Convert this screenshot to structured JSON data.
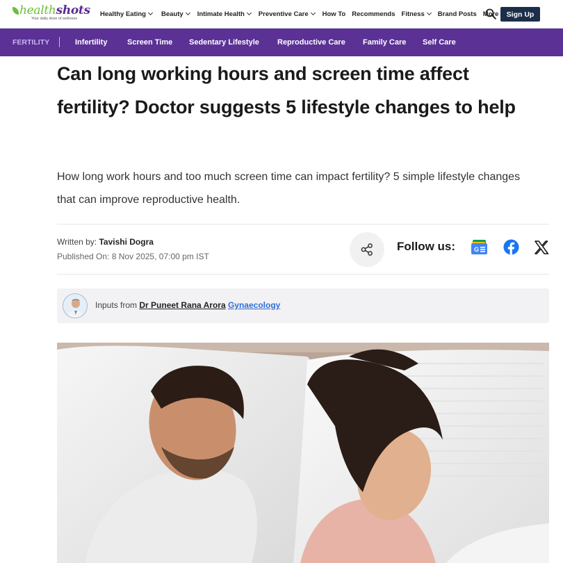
{
  "brand": {
    "logo_prefix": "health",
    "logo_suffix": "shots",
    "tagline": "Your daily dose of wellness",
    "colors": {
      "green": "#6abf3c",
      "purple": "#5b3196",
      "navy": "#1c2e4a"
    }
  },
  "header": {
    "nav": [
      {
        "label": "Healthy Eating",
        "dropdown": true
      },
      {
        "label": "Beauty",
        "dropdown": true
      },
      {
        "label": "Intimate Health",
        "dropdown": true
      },
      {
        "label": "Preventive Care",
        "dropdown": true
      },
      {
        "label": "How To",
        "dropdown": false
      },
      {
        "label": "Recommends",
        "dropdown": false
      },
      {
        "label": "Fitness",
        "dropdown": true
      },
      {
        "label": "Brand Posts",
        "dropdown": false
      },
      {
        "label": "More",
        "dropdown": true
      }
    ],
    "search_icon": "search-icon",
    "signup_label": "Sign Up"
  },
  "subnav": {
    "category": "FERTILITY",
    "items": [
      "Infertility",
      "Screen Time",
      "Sedentary Lifestyle",
      "Reproductive Care",
      "Family Care",
      "Self Care"
    ]
  },
  "article": {
    "headline": "Can long working hours and screen time affect fertility? Doctor suggests 5 lifestyle changes to help",
    "summary": "How long work hours and too much screen time can impact fertility? 5 simple lifestyle changes that can improve reproductive health.",
    "author_prefix": "Written by: ",
    "author": "Tavishi Dogra",
    "published_prefix": "Published On: ",
    "published": "8 Nov 2025, 07:00 pm IST",
    "follow_label": "Follow us:",
    "social_icons": [
      "google-news-icon",
      "facebook-icon",
      "x-icon"
    ],
    "inputs_prefix": "Inputs from ",
    "expert": "Dr Puneet Rana Arora",
    "specialty": "Gynaecology"
  }
}
